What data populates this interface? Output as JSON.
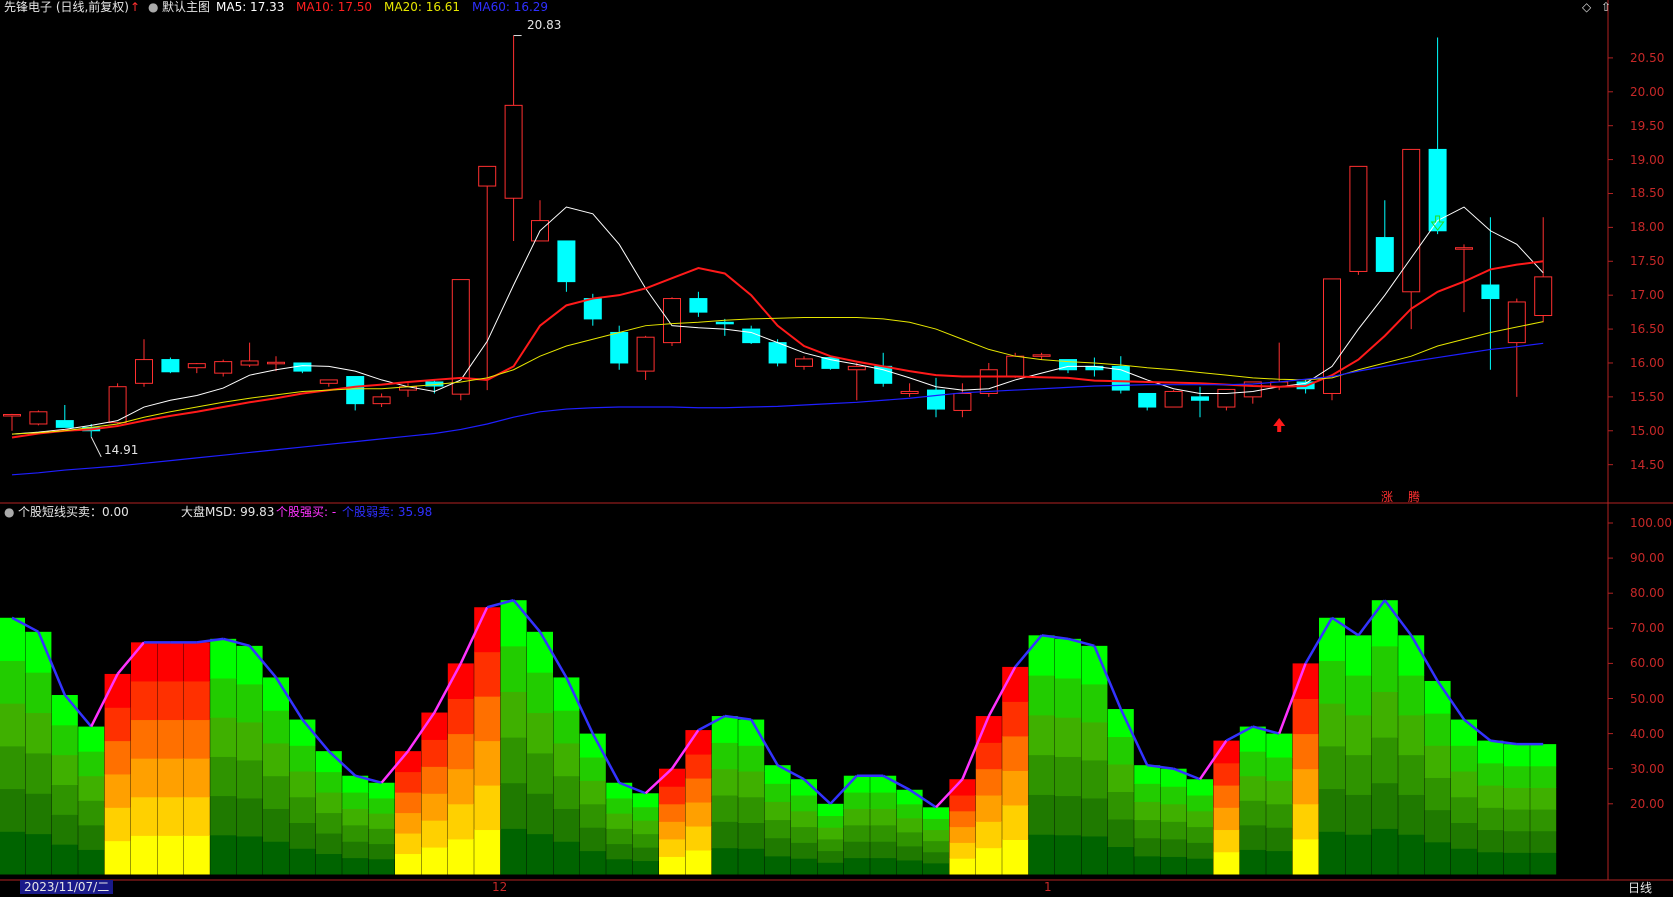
{
  "main_header": {
    "security": "先锋电子 (日线,前复权)",
    "template": "默认主图",
    "ma5": "MA5: 17.33",
    "ma10": "MA10: 17.50",
    "ma20": "MA20: 16.61",
    "ma60": "MA60: 16.29",
    "high_label": "20.83",
    "low_label": "14.91",
    "markers": {
      "zhang": "涨",
      "teng": "腾"
    }
  },
  "sub_header": {
    "indicator": "个股短线买卖：0.00",
    "msd": "大盘MSD: 99.83",
    "strong_buy": "个股强买: -",
    "weak_sell": "个股弱卖: 35.98"
  },
  "price_axis": [
    "20.50",
    "20.00",
    "19.50",
    "19.00",
    "18.50",
    "18.00",
    "17.50",
    "17.00",
    "16.50",
    "16.00",
    "15.50",
    "15.00",
    "14.50"
  ],
  "sub_axis": [
    "100.00",
    "90.00",
    "80.00",
    "70.00",
    "60.00",
    "50.00",
    "40.00",
    "30.00",
    "20.00"
  ],
  "bottom_bar": {
    "cursor_date": "2023/11/07/二",
    "month_12": "12",
    "month_1": "1",
    "period": "日线"
  },
  "colors": {
    "ma5": "#ffffff",
    "ma10": "#ff1a1a",
    "ma20": "#e6e600",
    "ma60": "#1f1fff",
    "up": "#ff3030",
    "down": "#00ffff",
    "line": "#3333ff",
    "line_rise": "#ff33ff"
  },
  "chart_data": {
    "type": "candlestick",
    "price_range": [
      14.2,
      21.0
    ],
    "candles": [
      [
        15.22,
        15.25,
        15.0,
        15.24
      ],
      [
        15.1,
        15.3,
        15.08,
        15.28
      ],
      [
        15.15,
        15.38,
        15.05,
        15.05
      ],
      [
        15.05,
        15.1,
        14.91,
        15.0
      ],
      [
        15.12,
        15.7,
        15.1,
        15.65
      ],
      [
        15.7,
        16.35,
        15.65,
        16.05
      ],
      [
        16.05,
        16.08,
        15.85,
        15.87
      ],
      [
        15.93,
        16.0,
        15.85,
        15.99
      ],
      [
        15.85,
        16.05,
        15.8,
        16.02
      ],
      [
        15.97,
        16.3,
        15.94,
        16.03
      ],
      [
        16.0,
        16.1,
        15.88,
        16.01
      ],
      [
        16.0,
        16.0,
        15.85,
        15.88
      ],
      [
        15.7,
        15.75,
        15.65,
        15.75
      ],
      [
        15.8,
        15.8,
        15.3,
        15.4
      ],
      [
        15.4,
        15.55,
        15.35,
        15.5
      ],
      [
        15.6,
        15.7,
        15.5,
        15.65
      ],
      [
        15.72,
        15.75,
        15.55,
        15.66
      ],
      [
        15.54,
        17.23,
        15.45,
        17.23
      ],
      [
        18.61,
        18.9,
        15.6,
        18.9
      ],
      [
        18.43,
        20.83,
        17.8,
        19.8
      ],
      [
        17.8,
        18.4,
        17.8,
        18.1
      ],
      [
        17.8,
        17.8,
        17.05,
        17.2
      ],
      [
        16.95,
        17.02,
        16.55,
        16.65
      ],
      [
        16.45,
        16.55,
        15.9,
        16.0
      ],
      [
        15.88,
        16.4,
        15.75,
        16.38
      ],
      [
        16.3,
        16.97,
        16.25,
        16.95
      ],
      [
        16.95,
        17.05,
        16.68,
        16.75
      ],
      [
        16.6,
        16.65,
        16.4,
        16.58
      ],
      [
        16.5,
        16.55,
        16.28,
        16.3
      ],
      [
        16.3,
        16.35,
        15.95,
        16.0
      ],
      [
        15.95,
        16.1,
        15.9,
        16.06
      ],
      [
        16.08,
        16.08,
        15.9,
        15.92
      ],
      [
        15.9,
        16.0,
        15.45,
        15.95
      ],
      [
        15.95,
        16.15,
        15.65,
        15.7
      ],
      [
        15.55,
        15.7,
        15.5,
        15.58
      ],
      [
        15.6,
        15.78,
        15.2,
        15.32
      ],
      [
        15.3,
        15.7,
        15.2,
        15.55
      ],
      [
        15.55,
        16.0,
        15.5,
        15.9
      ],
      [
        15.8,
        16.15,
        15.78,
        16.1
      ],
      [
        16.1,
        16.15,
        16.05,
        16.12
      ],
      [
        16.05,
        16.05,
        15.85,
        15.9
      ],
      [
        15.95,
        16.08,
        15.8,
        15.9
      ],
      [
        15.95,
        16.1,
        15.55,
        15.6
      ],
      [
        15.55,
        15.55,
        15.3,
        15.35
      ],
      [
        15.35,
        15.6,
        15.35,
        15.58
      ],
      [
        15.5,
        15.65,
        15.2,
        15.45
      ],
      [
        15.35,
        15.6,
        15.3,
        15.61
      ],
      [
        15.5,
        15.72,
        15.4,
        15.72
      ],
      [
        15.65,
        16.3,
        15.6,
        15.72
      ],
      [
        15.72,
        15.75,
        15.55,
        15.62
      ],
      [
        15.55,
        17.24,
        15.45,
        17.24
      ],
      [
        17.35,
        18.9,
        17.3,
        18.9
      ],
      [
        17.85,
        18.4,
        17.5,
        17.35
      ],
      [
        17.05,
        19.15,
        16.5,
        19.15
      ],
      [
        19.15,
        20.8,
        17.9,
        17.95
      ],
      [
        17.7,
        17.75,
        16.75,
        17.7
      ],
      [
        17.15,
        18.15,
        15.9,
        16.95
      ],
      [
        16.3,
        16.95,
        15.5,
        16.9
      ],
      [
        16.7,
        18.15,
        16.6,
        17.27
      ]
    ],
    "ma_lines": [
      {
        "name": "MA5",
        "values": [
          14.95,
          14.98,
          15.02,
          15.08,
          15.15,
          15.35,
          15.45,
          15.52,
          15.63,
          15.82,
          15.9,
          15.96,
          15.95,
          15.88,
          15.75,
          15.65,
          15.58,
          15.75,
          16.32,
          17.15,
          17.95,
          18.3,
          18.2,
          17.75,
          17.1,
          16.55,
          16.52,
          16.5,
          16.45,
          16.3,
          16.15,
          16.05,
          15.98,
          15.9,
          15.78,
          15.65,
          15.6,
          15.62,
          15.75,
          15.85,
          15.95,
          15.95,
          15.9,
          15.75,
          15.62,
          15.55,
          15.55,
          15.58,
          15.65,
          15.7,
          15.95,
          16.5,
          17.0,
          17.55,
          18.1,
          18.3,
          17.95,
          17.75,
          17.33
        ]
      },
      {
        "name": "MA10",
        "values": [
          14.9,
          14.96,
          15.0,
          15.02,
          15.07,
          15.15,
          15.22,
          15.28,
          15.35,
          15.42,
          15.48,
          15.55,
          15.6,
          15.65,
          15.68,
          15.72,
          15.75,
          15.78,
          15.75,
          15.95,
          16.55,
          16.85,
          16.95,
          17.0,
          17.1,
          17.25,
          17.4,
          17.32,
          17.0,
          16.55,
          16.25,
          16.1,
          16.02,
          15.95,
          15.88,
          15.82,
          15.8,
          15.8,
          15.8,
          15.79,
          15.78,
          15.74,
          15.73,
          15.72,
          15.71,
          15.7,
          15.68,
          15.66,
          15.65,
          15.66,
          15.82,
          16.05,
          16.4,
          16.8,
          17.05,
          17.2,
          17.38,
          17.45,
          17.5
        ]
      },
      {
        "name": "MA20",
        "values": [
          14.95,
          14.97,
          15.0,
          15.05,
          15.1,
          15.2,
          15.28,
          15.35,
          15.42,
          15.48,
          15.53,
          15.58,
          15.6,
          15.62,
          15.62,
          15.65,
          15.68,
          15.72,
          15.78,
          15.9,
          16.1,
          16.25,
          16.35,
          16.45,
          16.55,
          16.58,
          16.6,
          16.63,
          16.65,
          16.66,
          16.67,
          16.67,
          16.67,
          16.65,
          16.6,
          16.5,
          16.35,
          16.2,
          16.1,
          16.05,
          16.02,
          16.0,
          15.97,
          15.93,
          15.9,
          15.86,
          15.82,
          15.78,
          15.76,
          15.75,
          15.78,
          15.9,
          16.0,
          16.1,
          16.25,
          16.35,
          16.45,
          16.53,
          16.61
        ]
      },
      {
        "name": "MA60",
        "values": [
          14.35,
          14.38,
          14.42,
          14.45,
          14.48,
          14.52,
          14.56,
          14.6,
          14.64,
          14.68,
          14.72,
          14.76,
          14.8,
          14.84,
          14.88,
          14.92,
          14.96,
          15.02,
          15.1,
          15.2,
          15.28,
          15.32,
          15.34,
          15.35,
          15.35,
          15.35,
          15.34,
          15.34,
          15.35,
          15.36,
          15.38,
          15.4,
          15.42,
          15.45,
          15.48,
          15.52,
          15.56,
          15.58,
          15.6,
          15.62,
          15.64,
          15.66,
          15.67,
          15.68,
          15.68,
          15.68,
          15.68,
          15.69,
          15.72,
          15.76,
          15.8,
          15.88,
          15.95,
          16.02,
          16.08,
          16.14,
          16.2,
          16.24,
          16.29
        ]
      }
    ],
    "sub_chart": {
      "range": [
        0,
        100
      ],
      "columns": [
        [
          73,
          73,
          0
        ],
        [
          69,
          69,
          0
        ],
        [
          51,
          51,
          0
        ],
        [
          42,
          42,
          0
        ],
        [
          57,
          57,
          1
        ],
        [
          66,
          66,
          1
        ],
        [
          66,
          66,
          1
        ],
        [
          66,
          66,
          1
        ],
        [
          67,
          67,
          0
        ],
        [
          65,
          65,
          0
        ],
        [
          56,
          56,
          0
        ],
        [
          44,
          44,
          0
        ],
        [
          35,
          35,
          0
        ],
        [
          28,
          28,
          0
        ],
        [
          26,
          26,
          0
        ],
        [
          35,
          35,
          1
        ],
        [
          46,
          46,
          1
        ],
        [
          60,
          60,
          1
        ],
        [
          76,
          76,
          1
        ],
        [
          78,
          78,
          0
        ],
        [
          69,
          69,
          0
        ],
        [
          56,
          56,
          0
        ],
        [
          40,
          40,
          0
        ],
        [
          26,
          26,
          0
        ],
        [
          23,
          23,
          0
        ],
        [
          30,
          30,
          1
        ],
        [
          41,
          41,
          1
        ],
        [
          45,
          45,
          0
        ],
        [
          44,
          44,
          0
        ],
        [
          31,
          31,
          0
        ],
        [
          27,
          27,
          0
        ],
        [
          20,
          20,
          0
        ],
        [
          28,
          28,
          0
        ],
        [
          28,
          28,
          0
        ],
        [
          24,
          24,
          0
        ],
        [
          19,
          19,
          0
        ],
        [
          27,
          27,
          1
        ],
        [
          45,
          45,
          1
        ],
        [
          59,
          59,
          1
        ],
        [
          68,
          68,
          0
        ],
        [
          67,
          67,
          0
        ],
        [
          65,
          65,
          0
        ],
        [
          47,
          47,
          0
        ],
        [
          31,
          31,
          0
        ],
        [
          30,
          30,
          0
        ],
        [
          27,
          27,
          0
        ],
        [
          38,
          38,
          1
        ],
        [
          42,
          42,
          0
        ],
        [
          40,
          40,
          0
        ],
        [
          60,
          60,
          1
        ],
        [
          73,
          73,
          0
        ],
        [
          68,
          68,
          0
        ],
        [
          78,
          78,
          0
        ],
        [
          68,
          68,
          0
        ],
        [
          55,
          55,
          0
        ],
        [
          44,
          44,
          0
        ],
        [
          38,
          38,
          0
        ],
        [
          37,
          37,
          0
        ],
        [
          37,
          37,
          0
        ]
      ]
    }
  }
}
